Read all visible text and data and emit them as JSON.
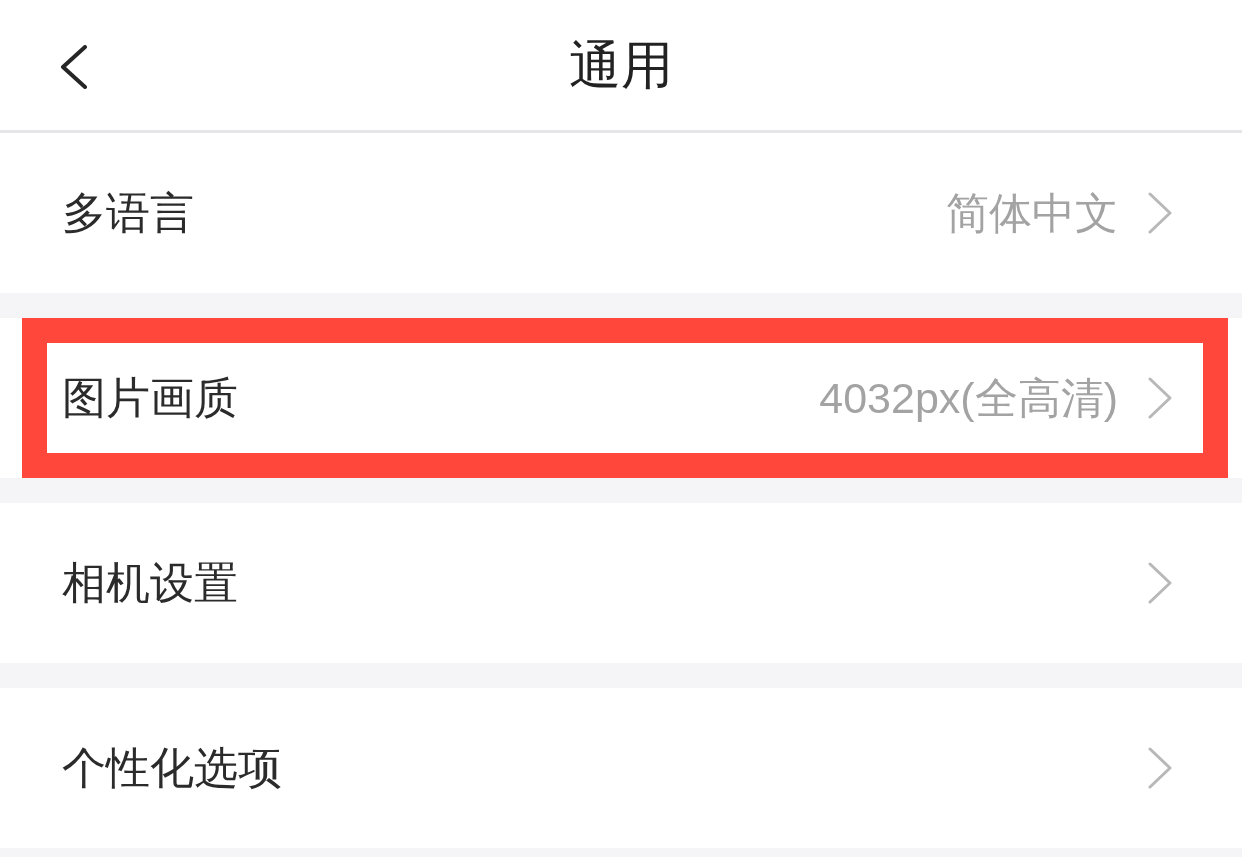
{
  "header": {
    "title": "通用"
  },
  "items": [
    {
      "label": "多语言",
      "value": "简体中文",
      "highlighted": false
    },
    {
      "label": "图片画质",
      "value": "4032px(全高清)",
      "highlighted": true
    },
    {
      "label": "相机设置",
      "highlighted": false
    },
    {
      "label": "个性化选项",
      "highlighted": false
    }
  ]
}
